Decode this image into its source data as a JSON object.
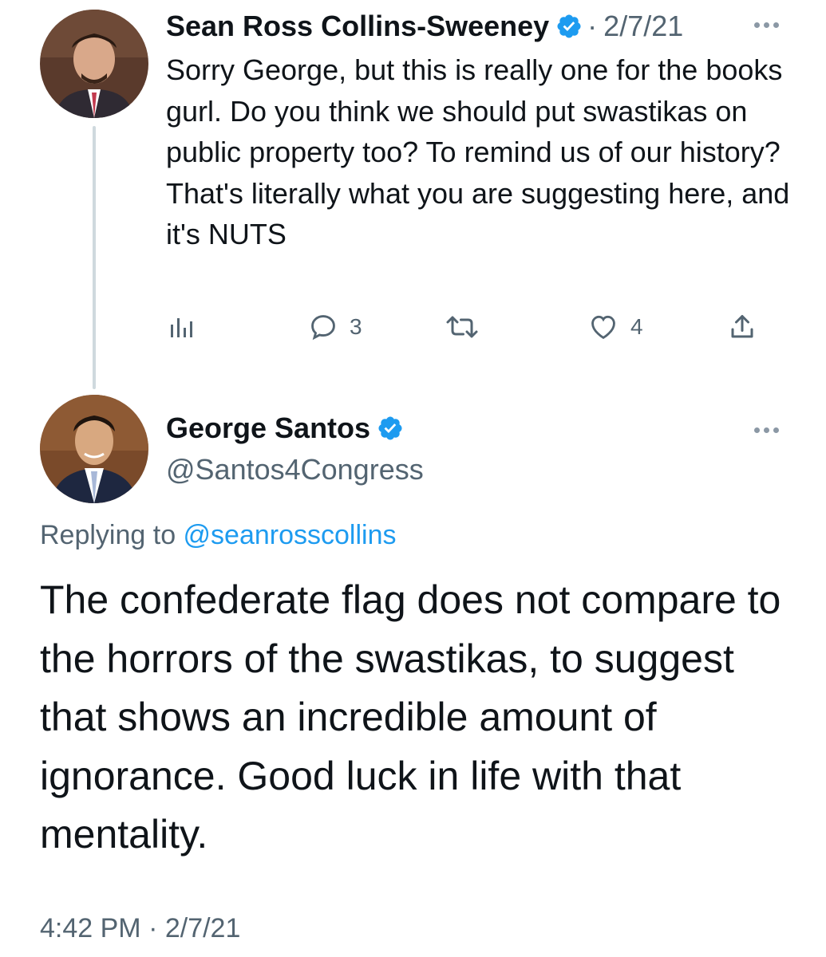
{
  "parent_tweet": {
    "author_name": "Sean Ross Collins-Sweeney",
    "separator": "·",
    "date": "2/7/21",
    "text": "Sorry George, but this is really one for the books gurl.  Do you think we should put swastikas on public property too? To remind us of our history? That's literally what you are suggesting here, and it's NUTS",
    "actions": {
      "views_icon": "analytics-icon",
      "reply_count": "3",
      "retweet_count": "",
      "like_count": "4",
      "share_icon": "share-icon"
    }
  },
  "main_tweet": {
    "author_name": "George Santos",
    "handle": "@Santos4Congress",
    "replying_prefix": "Replying to ",
    "replying_to": "@seanrosscollins",
    "text": "The confederate flag does not compare to the horrors of the swastikas, to suggest that shows an incredible amount of ignorance. Good luck in life with that mentality.",
    "timestamp": "4:42 PM · 2/7/21"
  },
  "colors": {
    "verified_badge": "#1d9bf0",
    "link": "#1d9bf0",
    "secondary_text": "#536471",
    "thread_line": "#cfd9de"
  }
}
